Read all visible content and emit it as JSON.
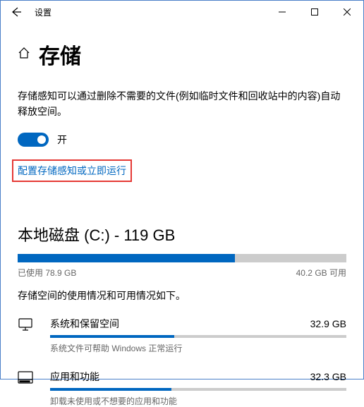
{
  "titlebar": {
    "title": "设置"
  },
  "page": {
    "title": "存储"
  },
  "storageSense": {
    "desc": "存储感知可以通过删除不需要的文件(例如临时文件和回收站中的内容)自动释放空间。",
    "toggle_label": "开",
    "configure_link": "配置存储感知或立即运行"
  },
  "disk": {
    "heading": "本地磁盘 (C:) - 119 GB",
    "used_label": "已使用 78.9 GB",
    "free_label": "40.2 GB 可用",
    "fill_percent": 66,
    "sub_desc": "存储空间的使用情况和可用情况如下。"
  },
  "categories": [
    {
      "name": "系统和保留空间",
      "size": "32.9 GB",
      "hint": "系统文件可帮助 Windows 正常运行",
      "fill": 42
    },
    {
      "name": "应用和功能",
      "size": "32.3 GB",
      "hint": "卸载未使用或不想要的应用和功能",
      "fill": 41
    }
  ]
}
